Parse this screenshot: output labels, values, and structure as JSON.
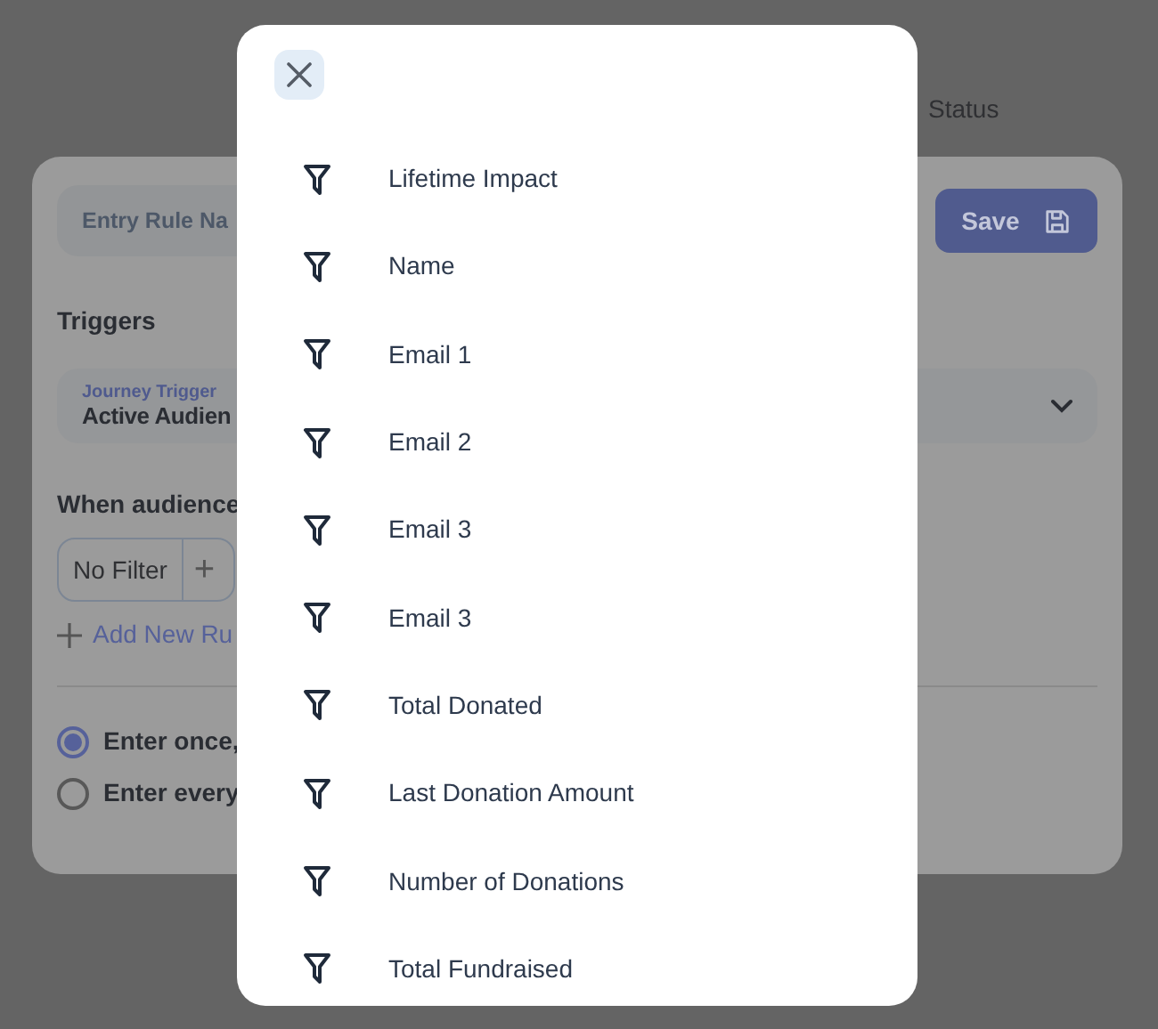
{
  "background": {
    "header_text": "Status",
    "entry_rule_field": {
      "label": "Entry Rule Na"
    },
    "save_button": {
      "label": "Save"
    },
    "triggers_heading": "Triggers",
    "trigger_select": {
      "label": "Journey Trigger",
      "value": "Active Audien"
    },
    "audience_heading": "When audience",
    "filter": {
      "value": "No Filter",
      "add": "+"
    },
    "add_rule": "Add New Ru",
    "entry_options": [
      {
        "label": "Enter once,",
        "selected": true
      },
      {
        "label": "Enter every",
        "selected": false
      }
    ]
  },
  "modal": {
    "items": [
      {
        "label": "Lifetime Impact"
      },
      {
        "label": "Name"
      },
      {
        "label": "Email 1"
      },
      {
        "label": "Email 2"
      },
      {
        "label": "Email 3"
      },
      {
        "label": "Email 3"
      },
      {
        "label": "Total Donated"
      },
      {
        "label": "Last Donation Amount"
      },
      {
        "label": "Number of Donations"
      },
      {
        "label": "Total Fundraised"
      }
    ]
  }
}
